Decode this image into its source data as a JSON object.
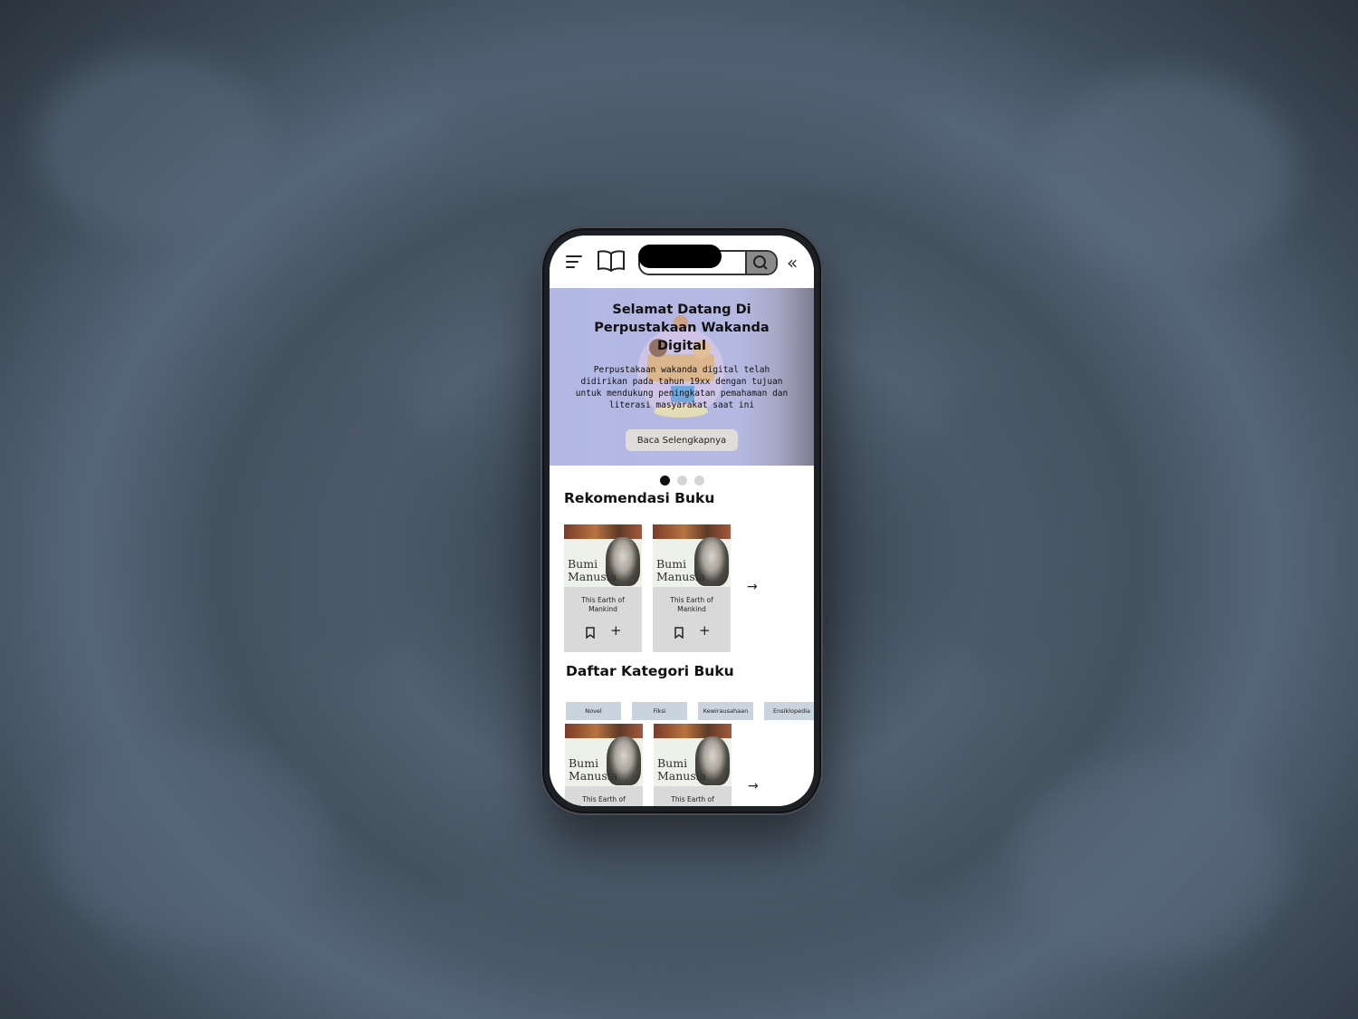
{
  "header": {
    "search_placeholder": ""
  },
  "hero": {
    "title": "Selamat Datang Di Perpustakaan Wakanda Digital",
    "description": "Perpustakaan wakanda digital telah didirikan pada tahun 19xx dengan tujuan untuk mendukung peningkatan pemahaman dan literasi masyarakat saat ini",
    "button_label": "Baca Selengkapnya",
    "carousel_active_index": 0,
    "carousel_count": 3
  },
  "recommendations": {
    "title": "Rekomendasi Buku",
    "books": [
      {
        "cover_title": "Bumi Manusia",
        "subtitle": "This Earth of Mankind"
      },
      {
        "cover_title": "Bumi Manusia",
        "subtitle": "This Earth of Mankind"
      }
    ]
  },
  "categories": {
    "title": "Daftar Kategori Buku",
    "items": [
      "Novel",
      "Fiksi",
      "Kewirausahaan",
      "Ensiklopedia"
    ],
    "books": [
      {
        "cover_title": "Bumi Manusia",
        "subtitle": "This Earth of"
      },
      {
        "cover_title": "Bumi Manusia",
        "subtitle": "This Earth of"
      }
    ]
  },
  "colors": {
    "hero_bg": "#b2b7e4",
    "card_bg": "#d9d9d9",
    "chip_bg": "#c9d4de"
  },
  "icons": [
    "menu-icon",
    "book-open-icon",
    "search-icon",
    "chevrons-left-icon",
    "bookmark-icon",
    "plus-icon",
    "arrow-right-icon"
  ]
}
